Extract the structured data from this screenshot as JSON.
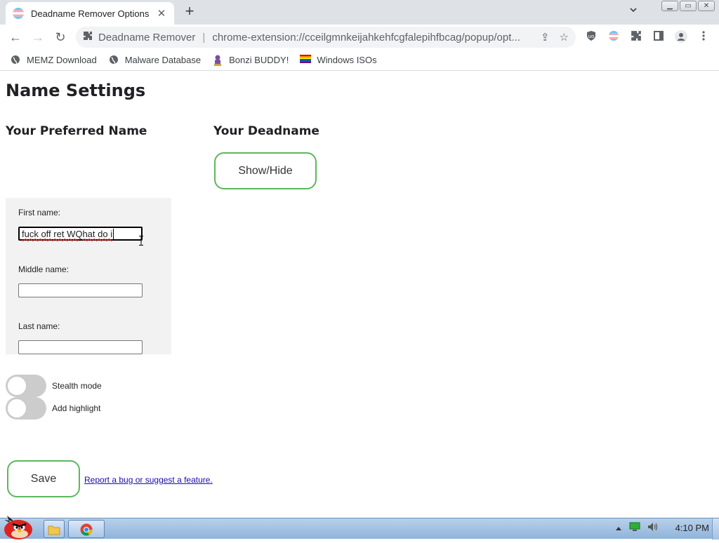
{
  "browser": {
    "tab": {
      "title": "Deadname Remover Options",
      "close_glyph": "✕",
      "favicon": "trans-flag-circle-icon"
    },
    "newtab_glyph": "+",
    "tab_search_glyph": "⌄",
    "window_buttons": [
      "▁",
      "▭",
      "✕"
    ],
    "nav": {
      "back": "←",
      "forward": "→",
      "reload": "↻"
    },
    "omnibox": {
      "site_name": "Deadname Remover",
      "separator": "|",
      "url": "chrome-extension://cceilgmnkeijahkehfcgfalepihfbcag/popup/opt...",
      "share_glyph": "⇪",
      "star_glyph": "☆"
    },
    "toolbar_icons": [
      "ublock-icon",
      "trans-flag-icon",
      "puzzle-icon",
      "side-panel-icon",
      "profile-icon",
      "menu-icon"
    ],
    "bookmarks": [
      {
        "label": "MEMZ Download",
        "icon": "globe-icon"
      },
      {
        "label": "Malware Database",
        "icon": "globe-icon"
      },
      {
        "label": "Bonzi BUDDY!",
        "icon": "bonzi-icon"
      },
      {
        "label": "Windows ISOs",
        "icon": "rainbow-flag-icon"
      }
    ]
  },
  "page": {
    "title": "Name Settings",
    "preferred_heading": "Your Preferred Name",
    "deadname_heading": "Your Deadname",
    "show_hide_label": "Show/Hide",
    "fields": {
      "first_label": "First name:",
      "first_value": "fuck off ret WQhat do i",
      "middle_label": "Middle name:",
      "middle_value": "",
      "last_label": "Last name:",
      "last_value": ""
    },
    "toggles": [
      {
        "label": "Stealth mode",
        "on": false
      },
      {
        "label": "Add highlight",
        "on": false
      }
    ],
    "save_label": "Save",
    "report_link": "Report a bug or suggest a feature.",
    "accent_color": "#5cb85c"
  },
  "taskbar": {
    "apps": [
      "angry-bird-start-icon",
      "explorer-icon",
      "chrome-icon"
    ],
    "clock": "4:10 PM",
    "tray_icons": [
      "tray-arrow-icon",
      "network-icon",
      "volume-icon"
    ]
  }
}
